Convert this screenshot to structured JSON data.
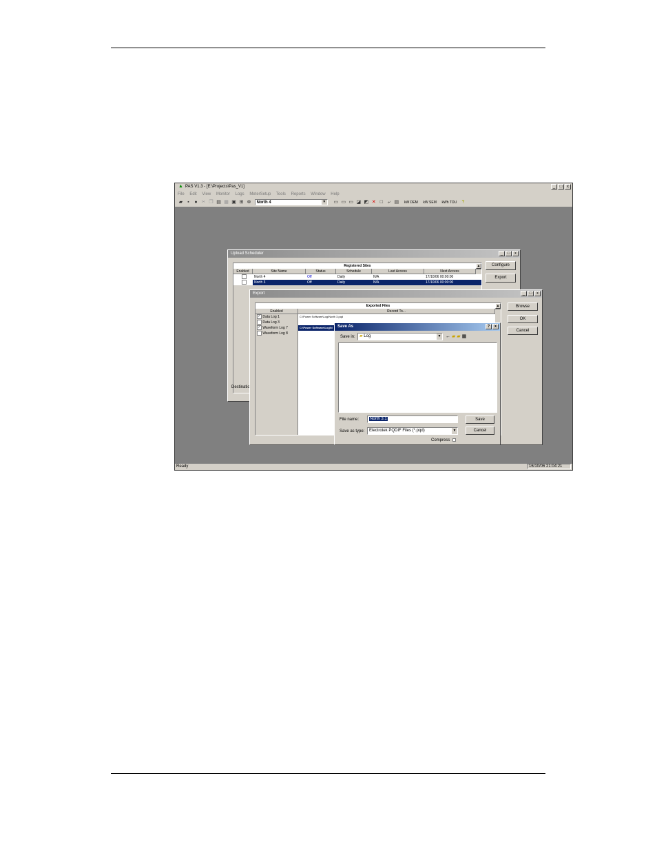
{
  "app": {
    "title": "PAS V1.3 - [E:\\Projects\\Pas_V1]",
    "window_buttons": [
      "_",
      "□",
      "x"
    ],
    "menu": [
      "File",
      "Edit",
      "View",
      "Monitor",
      "Logs",
      "MeterSetup",
      "Tools",
      "Reports",
      "Window",
      "Help"
    ],
    "site_select": "North 4",
    "toolbar_tags": [
      "kW DEM",
      "kW SEM",
      "kWh TOU"
    ],
    "status_left": "Ready",
    "status_right": "16/10/06 21:04:21"
  },
  "scheduler": {
    "title": "Upload Scheduler",
    "section": "Registered Sites",
    "columns": [
      "Enabled",
      "Site Name",
      "Status",
      "Schedule",
      "Last Access",
      "Next Access"
    ],
    "rows": [
      {
        "name": "North 4",
        "status": "Off",
        "schedule": "Daily",
        "last": "N/A",
        "next": "17/10/06 00:00:00",
        "selected": false
      },
      {
        "name": "North 3",
        "status": "Off",
        "schedule": "Daily",
        "last": "N/A",
        "next": "17/10/06 00:00:00",
        "selected": true
      }
    ],
    "configure_label": "Configure",
    "export_label": "Export",
    "destination_label": "Destinatio"
  },
  "export": {
    "title": "Export",
    "section": "Exported Files",
    "columns": [
      "Enabled",
      "Record To..."
    ],
    "rows": [
      {
        "checked": true,
        "name": "Data Log 1",
        "path": "C:\\Power Software\\Log\\North 3.pqd"
      },
      {
        "checked": false,
        "name": "Data Log 3",
        "path": ""
      },
      {
        "checked": true,
        "name": "Waveform Log 7",
        "path": "C:\\Power Software\\Log\\N"
      },
      {
        "checked": false,
        "name": "Waveform Log 8",
        "path": ""
      }
    ],
    "browse_label": "Browse",
    "ok_label": "OK",
    "cancel_label": "Cancel"
  },
  "saveas": {
    "title": "Save As",
    "title_buttons": [
      "?",
      "x"
    ],
    "save_in_label": "Save in:",
    "save_in_value": "Log",
    "file_name_label": "File name:",
    "file_name_value": "North 3.1",
    "save_type_label": "Save as type:",
    "save_type_value": "Electrotek PQDIF Files (*.pqd)",
    "compress_label": "Compress",
    "save_label": "Save",
    "cancel_label": "Cancel"
  }
}
